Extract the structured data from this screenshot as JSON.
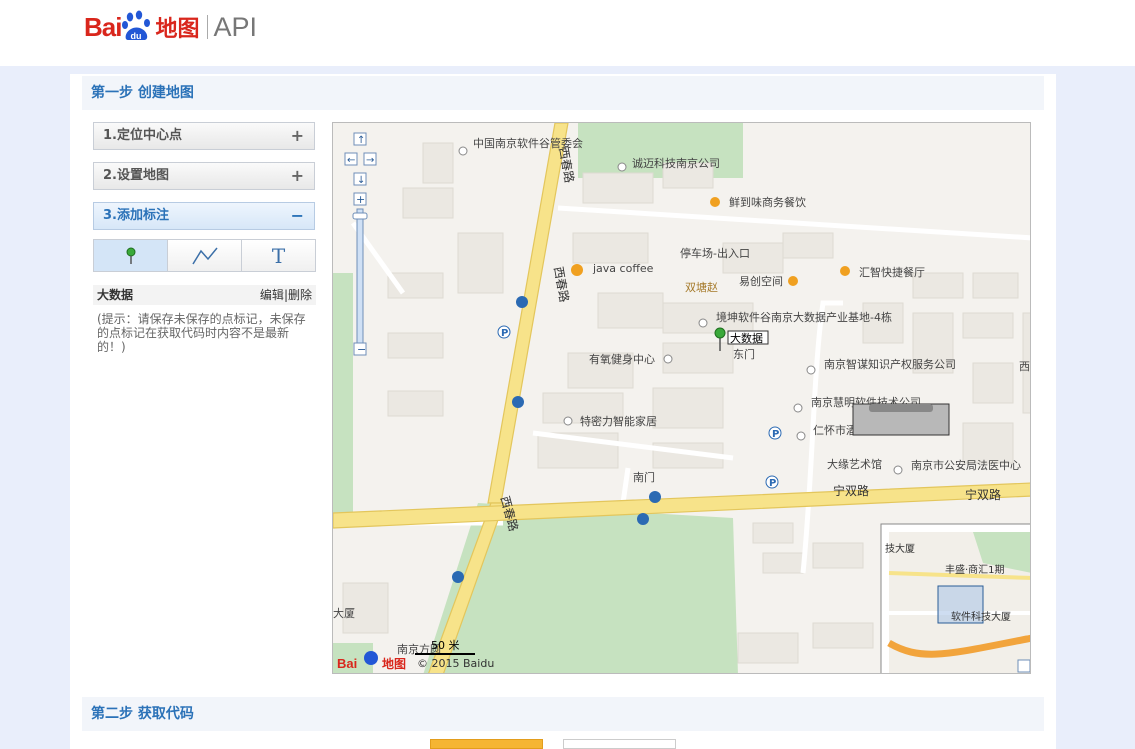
{
  "header": {
    "logo_text_bai": "Bai",
    "logo_text_du": "du",
    "logo_text_map": "地图",
    "logo_text_api": "API"
  },
  "step1": {
    "title": "第一步 创建地图"
  },
  "step2": {
    "title": "第二步 获取代码"
  },
  "accordion": [
    {
      "label": "1.定位中心点",
      "sign": "+"
    },
    {
      "label": "2.设置地图",
      "sign": "+"
    },
    {
      "label": "3.添加标注",
      "sign": "−"
    }
  ],
  "tools": {
    "marker": "marker-icon",
    "polyline": "polyline-icon",
    "text": "T"
  },
  "marker_item": {
    "name": "大数据",
    "edit": "编辑",
    "sep": "|",
    "delete": "删除"
  },
  "hint": "(提示：请保存未保存的点标记，未保存的点标记在获取代码时内容不是最新的！)",
  "map": {
    "pois": [
      "中国南京软件谷管委会",
      "诚迈科技南京公司",
      "鲜到味商务餐饮",
      "停车场-出入口",
      "java coffee",
      "易创空间",
      "汇智快捷餐厅",
      "双塘赵",
      "境坤软件谷南京大数据产业基地-4栋",
      "有氧健身中心",
      "东门",
      "南京智谋知识产权服务公司",
      "南京慧明软件技术公司",
      "仁怀市酒业研究会江苏分会",
      "特密力智能家居",
      "大缘艺术馆",
      "南京市公安局法医中心",
      "南门",
      "宁双路",
      "宁双路",
      "西春路",
      "西春路",
      "西春路",
      "西",
      "大厦",
      "南京方圆"
    ],
    "marker_label": "大数据",
    "scale": "50 米",
    "copyright": "© 2015 Baidu",
    "overview": {
      "labels": [
        "技大厦",
        "丰盛·商汇1期",
        "软件科技大厦"
      ]
    }
  },
  "colors": {
    "accent": "#2b72b8",
    "brand_red": "#d9261c",
    "road_yellow": "#f7e38a",
    "park_green": "#c6e2c0"
  }
}
